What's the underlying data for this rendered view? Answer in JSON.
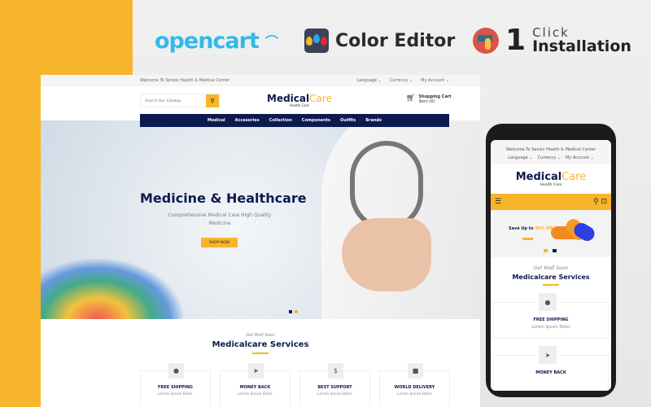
{
  "badges": {
    "opencart": "opencart",
    "color_editor": "Color Editor",
    "one": "1",
    "click": "Click",
    "installation": "Installation"
  },
  "colors": {
    "accent": "#f7b52c",
    "navy": "#0c1a4f",
    "opencart_blue": "#34b8e9"
  },
  "desktop": {
    "topbar": {
      "welcome": "Welcome To Sensiv Health & Medical Center",
      "language": "Language ⌄",
      "currency": "Currency ⌄",
      "account": "My Account ⌄"
    },
    "search": {
      "placeholder": "Search Our Catalog",
      "icon": "search-icon"
    },
    "logo": {
      "medical": "Medical",
      "care": "Care",
      "tagline": "Health Care"
    },
    "cart": {
      "title": "Shopping Cart",
      "items": "Item (0)"
    },
    "nav": [
      "Medical",
      "Accesories",
      "Collection",
      "Components",
      "Outfits",
      "Brands"
    ],
    "hero": {
      "title": "Medicine & Healthcare",
      "subtitle": "Comprehensive Medical Care High Quality Medicine",
      "button": "SHOP NOW"
    },
    "services": {
      "kicker": "Get Well Soon",
      "title": "Medicalcare Services",
      "items": [
        {
          "icon": "globe-icon",
          "title": "FREE SHIPPING",
          "desc": "Lorem Ipsum Dolor"
        },
        {
          "icon": "paper-plane-icon",
          "title": "MONEY BACK",
          "desc": "Lorem Ipsum Dolor"
        },
        {
          "icon": "dollar-icon",
          "title": "BEST SUPPORT",
          "desc": "Lorem Ipsum Dolor"
        },
        {
          "icon": "lock-icon",
          "title": "WORLD DELIVERY",
          "desc": "Lorem Ipsum Dolor"
        }
      ]
    }
  },
  "mobile": {
    "welcome": "Welcome To Sensiv Health & Medical Center",
    "language": "Language ⌄",
    "currency": "Currency ⌄",
    "account": "My Account ⌄",
    "banner": {
      "text": "Save Up to ",
      "highlight": "40% Off"
    },
    "services": {
      "kicker": "Get Well Soon",
      "title": "Medicalcare Services",
      "items": [
        {
          "title": "FREE SHIPPING",
          "desc": "Lorem Ipsum Dolor"
        },
        {
          "title": "MONEY BACK"
        }
      ]
    }
  }
}
